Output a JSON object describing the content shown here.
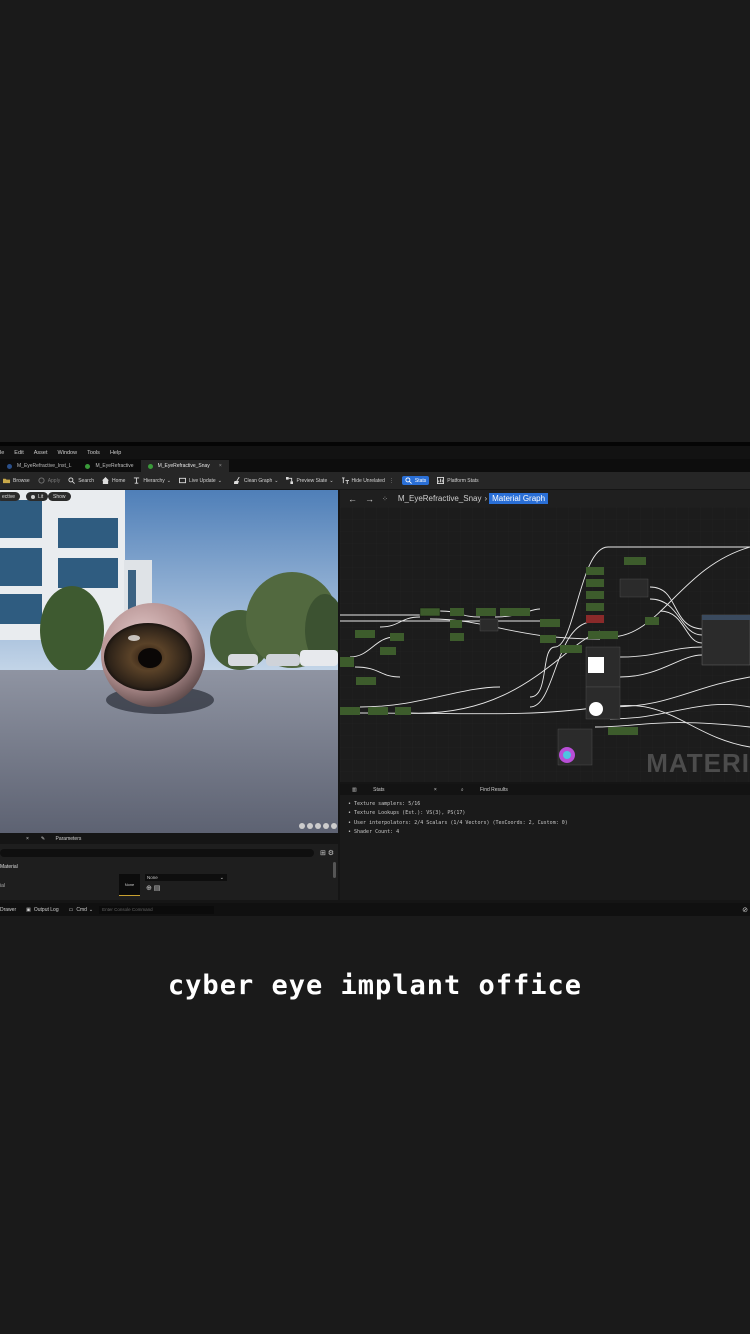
{
  "menu": [
    "le",
    "Edit",
    "Asset",
    "Window",
    "Tools",
    "Help"
  ],
  "tabs": [
    {
      "label": "M_EyeRefractive_Inst_L",
      "active": false
    },
    {
      "label": "M_EyeRefractive",
      "active": false
    },
    {
      "label": "M_EyeRefractive_Snay",
      "active": true,
      "close": "×"
    }
  ],
  "toolbar": {
    "browse": "Browse",
    "apply": "Apply",
    "search": "Search",
    "home": "Home",
    "hierarchy": "Hierarchy",
    "live_update": "Live Update",
    "clean_graph": "Clean Graph",
    "preview_state": "Preview State",
    "hide_unrelated": "Hide Unrelated",
    "stats": "Stats",
    "platform_stats": "Platform Stats"
  },
  "viewport": {
    "perspective": "ective",
    "lit": "Lit",
    "show": "Show"
  },
  "graph": {
    "title": "M_EyeRefractive_Snay",
    "crumb_hl": "Material Graph",
    "watermark": "MATERI"
  },
  "stats": {
    "tab_stats": "Stats",
    "tab_close": "×",
    "tab_find": "Find Results",
    "lines": [
      "•  Texture samplers: 5/16",
      "•  Texture Lookups (Est.): VS(3), PS(17)",
      "•  User interpolators: 2/4 Scalars (1/4 Vectors) (TexCoords: 2, Custom: 0)",
      "•  Shader Count: 4"
    ]
  },
  "params": {
    "tab_close": "×",
    "tab_params": "Parameters",
    "category": "Material",
    "row_label": "ial",
    "thumb_label": "None",
    "dropdown_value": "None"
  },
  "statusbar": {
    "drawer": "Drawer",
    "output_log": "Output Log",
    "cmd": "Cmd",
    "console_placeholder": "Enter Console Command"
  },
  "caption": "cyber eye implant office",
  "colors": {
    "accent": "#2a6fd6",
    "node_green": "#3d5c2c",
    "background": "#1a1a1a"
  }
}
